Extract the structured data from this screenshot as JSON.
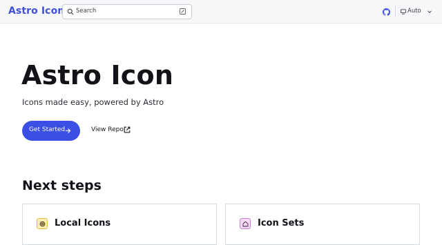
{
  "header": {
    "brand": "Astro Icon",
    "search": {
      "placeholder": "Search"
    },
    "theme_select": {
      "value": "Auto"
    }
  },
  "hero": {
    "title": "Astro Icon",
    "tagline": "Icons made easy, powered by Astro",
    "primary_action": "Get Started",
    "secondary_action": "View Repo"
  },
  "next_steps": {
    "title": "Next steps",
    "cards": [
      {
        "title": "Local Icons",
        "icon": "circle-icon"
      },
      {
        "title": "Icon Sets",
        "icon": "home-icon"
      }
    ]
  },
  "colors": {
    "accent": "#3b4fe4",
    "brand": "#3f51d9"
  }
}
